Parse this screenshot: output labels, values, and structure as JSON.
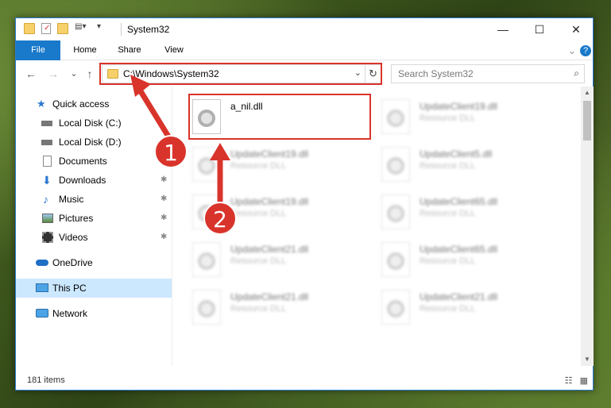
{
  "window": {
    "title": "System32",
    "controls": {
      "minimize": "—",
      "maximize": "☐",
      "close": "✕"
    }
  },
  "ribbon": {
    "tabs": [
      "File",
      "Home",
      "Share",
      "View"
    ],
    "help": "?"
  },
  "address": {
    "path": "C:\\Windows\\System32",
    "dropdown": "⌄",
    "refresh": "↻"
  },
  "search": {
    "placeholder": "Search System32",
    "icon": "search-icon"
  },
  "nav": {
    "back": "←",
    "forward": "→",
    "recent": "⌄",
    "up": "↑"
  },
  "sidebar": {
    "items": [
      {
        "label": "Quick access",
        "icon": "star-icon",
        "pinned": false
      },
      {
        "label": "Local Disk (C:)",
        "icon": "drive-icon",
        "pinned": false
      },
      {
        "label": "Local Disk (D:)",
        "icon": "drive-icon",
        "pinned": false
      },
      {
        "label": "Documents",
        "icon": "documents-icon",
        "pinned": true
      },
      {
        "label": "Downloads",
        "icon": "download-icon",
        "pinned": true
      },
      {
        "label": "Music",
        "icon": "music-icon",
        "pinned": true
      },
      {
        "label": "Pictures",
        "icon": "pictures-icon",
        "pinned": true
      },
      {
        "label": "Videos",
        "icon": "videos-icon",
        "pinned": true
      },
      {
        "label": "OneDrive",
        "icon": "onedrive-icon",
        "pinned": false
      },
      {
        "label": "This PC",
        "icon": "computer-icon",
        "pinned": false,
        "selected": true
      },
      {
        "label": "Network",
        "icon": "network-icon",
        "pinned": false
      }
    ],
    "pin_glyph": "📌"
  },
  "files": {
    "highlighted": {
      "name": "a_nil.dll",
      "type": ""
    },
    "blurred": [
      {
        "name": "UpdateClient19.dll",
        "type": "Resource DLL"
      },
      {
        "name": "UpdateClient19.dll",
        "type": "Resource DLL"
      },
      {
        "name": "UpdateClient5.dll",
        "type": "Resource DLL"
      },
      {
        "name": "UpdateClient19.dll",
        "type": "Resource DLL"
      },
      {
        "name": "UpdateClient65.dll",
        "type": "Resource DLL"
      },
      {
        "name": "UpdateClient21.dll",
        "type": "Resource DLL"
      },
      {
        "name": "UpdateClient65.dll",
        "type": "Resource DLL"
      },
      {
        "name": "UpdateClient21.dll",
        "type": "Resource DLL"
      },
      {
        "name": "UpdateClient21.dll",
        "type": "Resource DLL"
      }
    ]
  },
  "status": {
    "count": "181 items"
  },
  "annotations": {
    "step1": "1",
    "step2": "2",
    "color": "#d9342b"
  }
}
